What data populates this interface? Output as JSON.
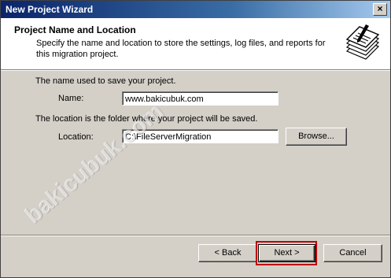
{
  "window": {
    "title": "New Project Wizard",
    "close_glyph": "×"
  },
  "header": {
    "title": "Project Name and Location",
    "subtitle": "Specify the name and location to store the settings, log files, and reports for this migration project.",
    "icon": "wizard-document-icon"
  },
  "form": {
    "name_intro": "The name used to save your project.",
    "name_label": "Name:",
    "name_value": "www.bakicubuk.com",
    "location_intro": "The location is the folder where your project will be saved.",
    "location_label": "Location:",
    "location_value": "C:\\FileServerMigration",
    "browse_label": "Browse..."
  },
  "buttons": {
    "back_label": "< Back",
    "next_label": "Next >",
    "cancel_label": "Cancel"
  },
  "watermark": {
    "text": "bakicubuk.com"
  },
  "colors": {
    "title_bar_start": "#0a246a",
    "title_bar_end": "#a6caf0",
    "dialog_face": "#d4d0c8",
    "highlight_box": "#c00000"
  }
}
